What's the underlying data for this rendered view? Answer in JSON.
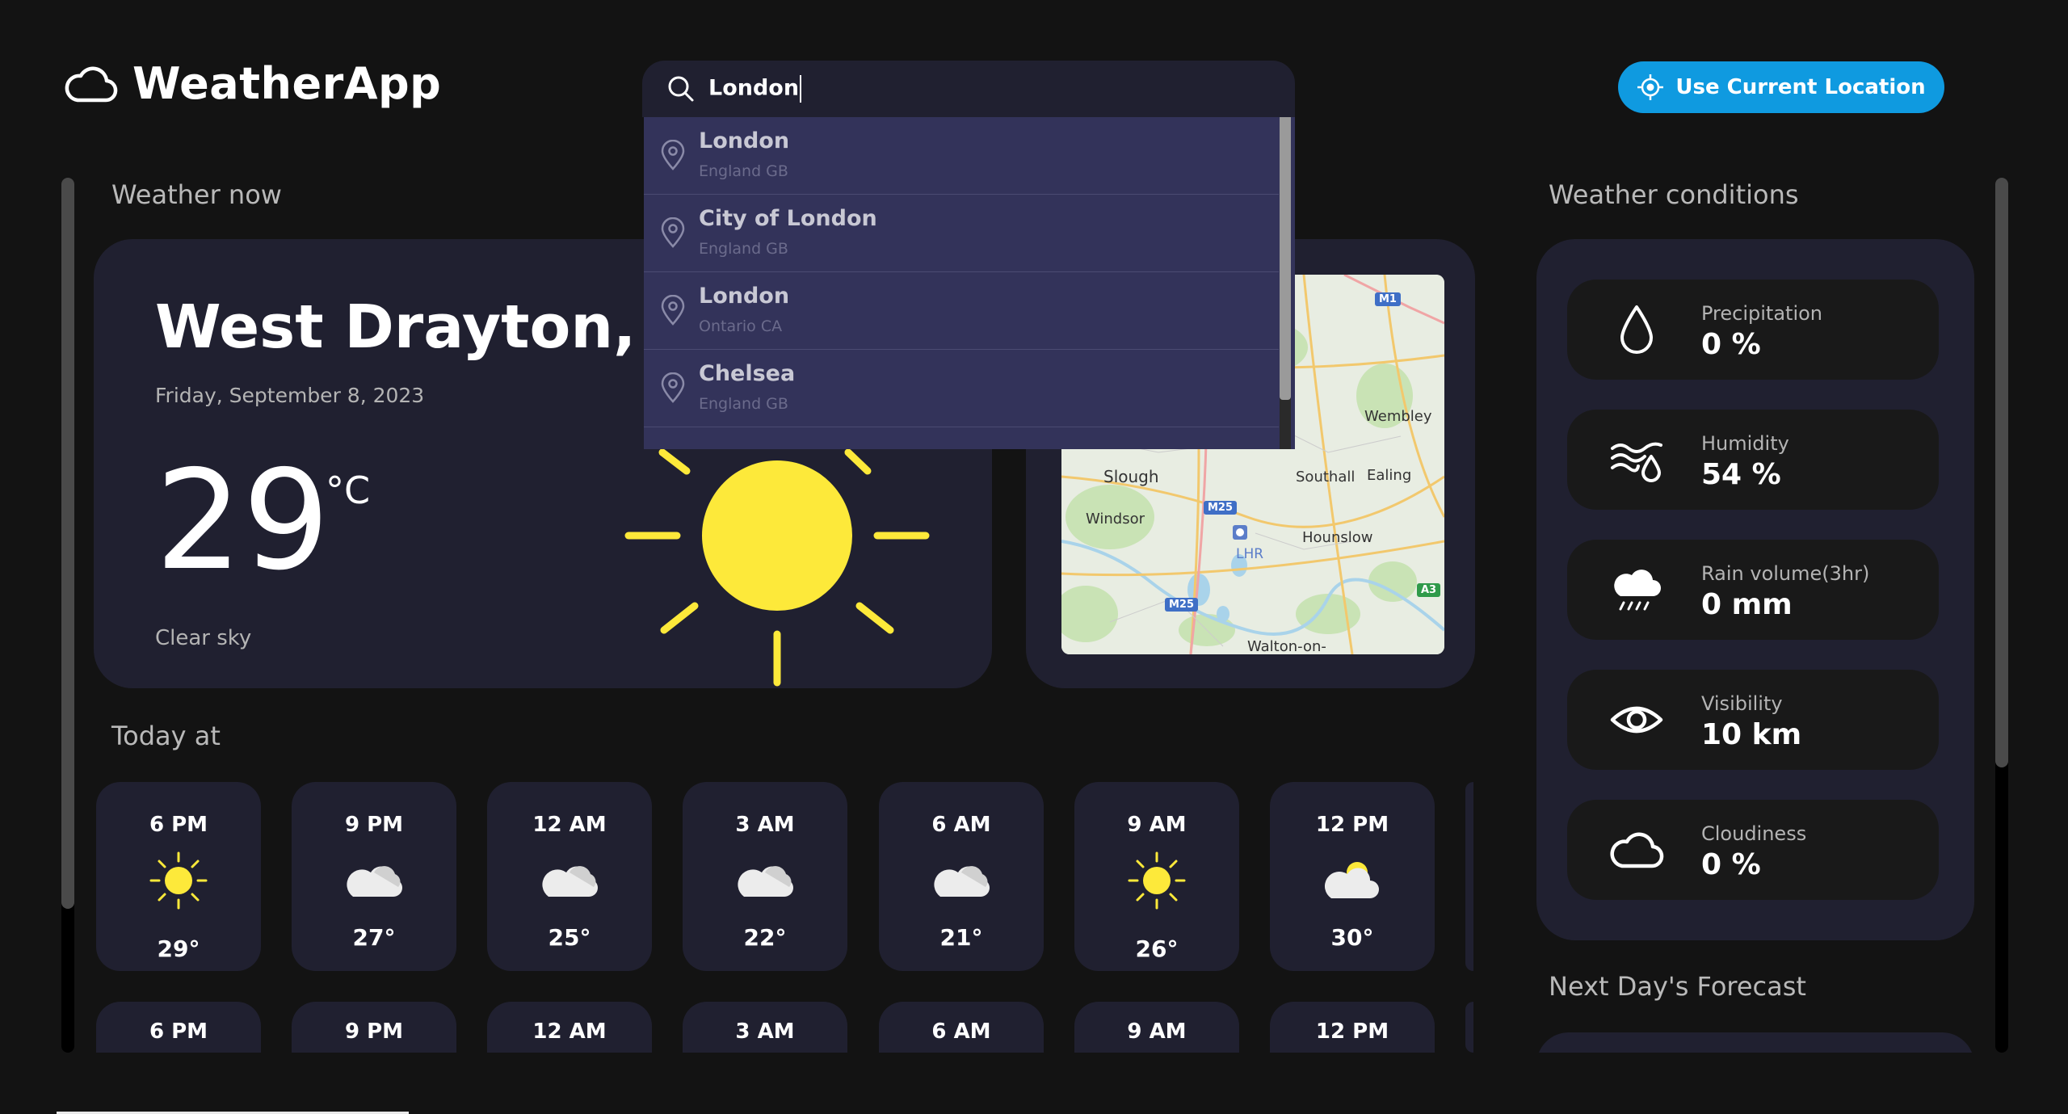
{
  "header": {
    "app_name": "WeatherApp",
    "search_value": "London",
    "location_button": "Use Current Location"
  },
  "suggestions": [
    {
      "name": "London",
      "region": "England GB"
    },
    {
      "name": "City of London",
      "region": "England GB"
    },
    {
      "name": "London",
      "region": "Ontario CA"
    },
    {
      "name": "Chelsea",
      "region": "England GB"
    }
  ],
  "sections": {
    "weather_now": "Weather now",
    "today_at": "Today at",
    "weather_conditions": "Weather conditions",
    "next_days": "Next Day's Forecast"
  },
  "current": {
    "city": "West Drayton, GB",
    "date": "Friday, September 8, 2023",
    "temp": "29",
    "unit": "°C",
    "description": "Clear sky",
    "icon": "sun-icon"
  },
  "map_labels": {
    "wembley": "Wembley",
    "slough": "Slough",
    "southall": "Southall",
    "ealing": "Ealing",
    "windsor": "Windsor",
    "hounslow": "Hounslow",
    "lhr": "LHR",
    "walton": "Walton-on-",
    "m1": "M1",
    "m25a": "M25",
    "m25b": "M25",
    "a3": "A3"
  },
  "hourly": [
    {
      "time": "6 PM",
      "icon": "sun-icon",
      "temp": "29°"
    },
    {
      "time": "9 PM",
      "icon": "cloud-icon",
      "temp": "27°"
    },
    {
      "time": "12 AM",
      "icon": "cloud-icon",
      "temp": "25°"
    },
    {
      "time": "3 AM",
      "icon": "cloud-icon",
      "temp": "22°"
    },
    {
      "time": "6 AM",
      "icon": "cloud-icon",
      "temp": "21°"
    },
    {
      "time": "9 AM",
      "icon": "sun-icon",
      "temp": "26°"
    },
    {
      "time": "12 PM",
      "icon": "partly-cloudy-icon",
      "temp": "30°"
    }
  ],
  "hourly_row2": [
    "6 PM",
    "9 PM",
    "12 AM",
    "3 AM",
    "6 AM",
    "9 AM",
    "12 PM"
  ],
  "conditions": [
    {
      "label": "Precipitation",
      "value": "0 %",
      "icon": "droplet-icon"
    },
    {
      "label": "Humidity",
      "value": "54 %",
      "icon": "humidity-icon"
    },
    {
      "label": "Rain volume(3hr)",
      "value": "0 mm",
      "icon": "rain-cloud-icon"
    },
    {
      "label": "Visibility",
      "value": "10 km",
      "icon": "eye-icon"
    },
    {
      "label": "Cloudiness",
      "value": "0 %",
      "icon": "cloud-icon"
    }
  ],
  "colors": {
    "background": "#131313",
    "card": "#202030",
    "accent": "#0f9ae0",
    "sun": "#fde93a",
    "dropdown": "#33335a"
  }
}
